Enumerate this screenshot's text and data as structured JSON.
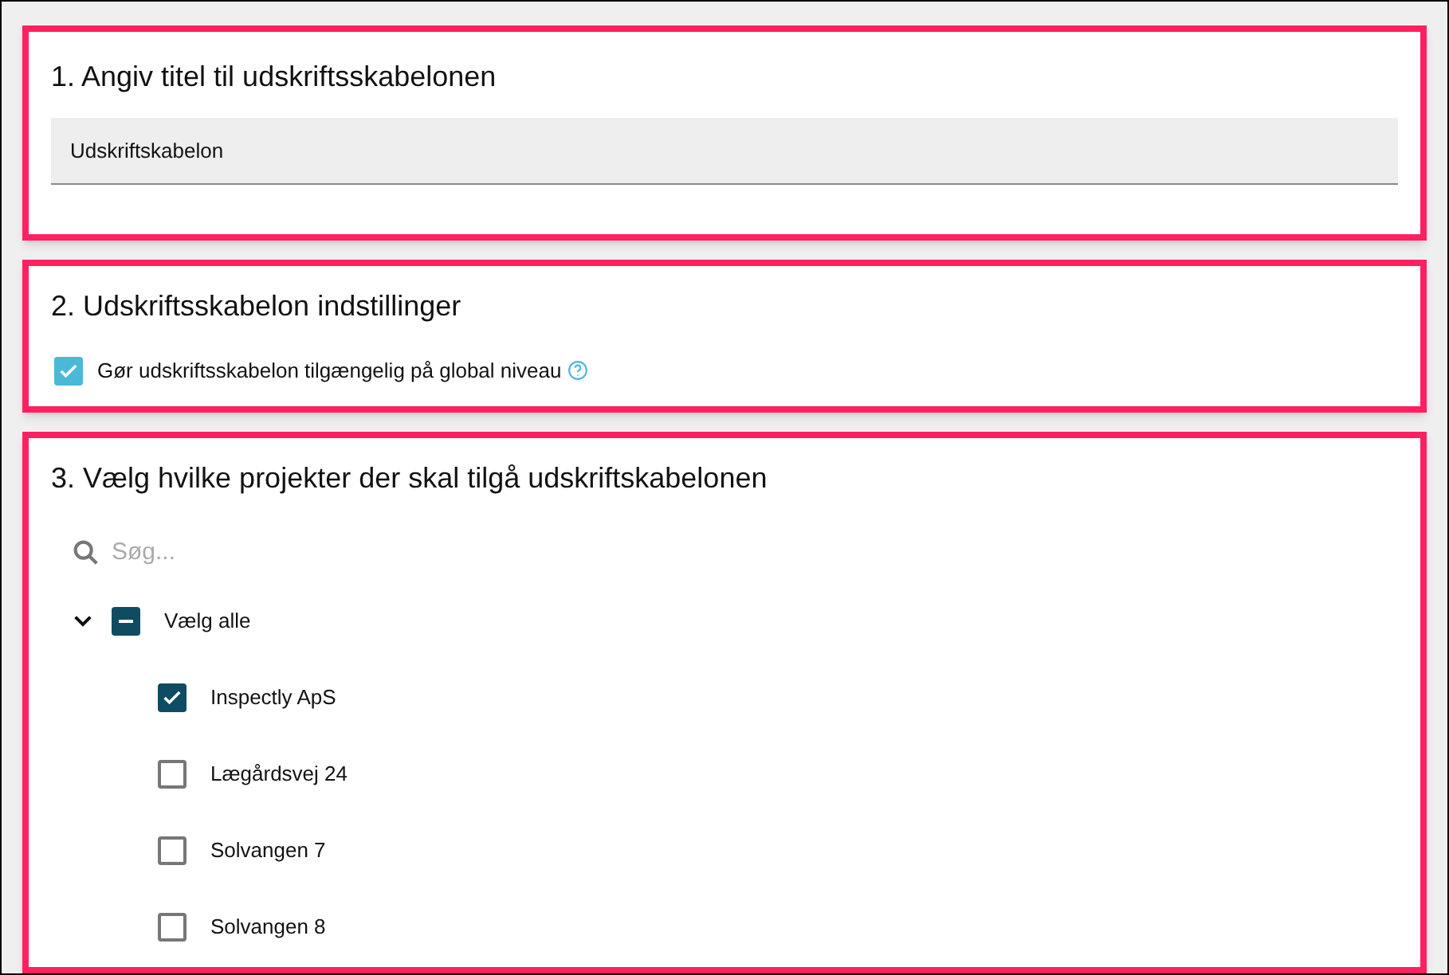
{
  "title_section": {
    "heading": "1. Angiv titel til udskriftsskabelonen",
    "title_field": {
      "value": "Udskriftskabelon"
    }
  },
  "settings_section": {
    "heading": "2. Udskriftsskabelon indstillinger",
    "global_option": {
      "label": "Gør udskriftsskabelon tilgængelig på global niveau",
      "checked": true
    }
  },
  "projects_section": {
    "heading": "3. Vælg hvilke projekter der skal tilgå udskriftskabelonen",
    "search": {
      "placeholder": "Søg..."
    },
    "tree": {
      "label": "Vælg alle",
      "expanded": true,
      "indeterminate": true,
      "children": [
        {
          "label": "Inspectly ApS",
          "checked": true
        },
        {
          "label": "Lægårdsvej 24",
          "checked": false
        },
        {
          "label": "Solvangen 7",
          "checked": false
        },
        {
          "label": "Solvangen 8",
          "checked": false
        }
      ]
    }
  }
}
